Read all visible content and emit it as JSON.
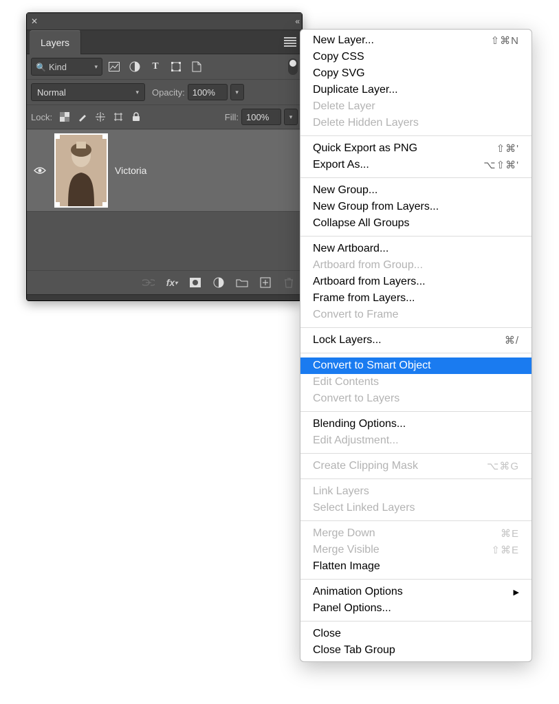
{
  "panel": {
    "tab_label": "Layers",
    "kind_filter_label": "Kind",
    "blend_mode": "Normal",
    "opacity_label": "Opacity:",
    "opacity_value": "100%",
    "lock_label": "Lock:",
    "fill_label": "Fill:",
    "fill_value": "100%",
    "layer": {
      "name": "Victoria"
    }
  },
  "menu": {
    "groups": [
      [
        {
          "label": "New Layer...",
          "shortcut": "⇧⌘N",
          "enabled": true
        },
        {
          "label": "Copy CSS",
          "enabled": true
        },
        {
          "label": "Copy SVG",
          "enabled": true
        },
        {
          "label": "Duplicate Layer...",
          "enabled": true
        },
        {
          "label": "Delete Layer",
          "enabled": false
        },
        {
          "label": "Delete Hidden Layers",
          "enabled": false
        }
      ],
      [
        {
          "label": "Quick Export as PNG",
          "shortcut": "⇧⌘'",
          "enabled": true
        },
        {
          "label": "Export As...",
          "shortcut": "⌥⇧⌘'",
          "enabled": true
        }
      ],
      [
        {
          "label": "New Group...",
          "enabled": true
        },
        {
          "label": "New Group from Layers...",
          "enabled": true
        },
        {
          "label": "Collapse All Groups",
          "enabled": true
        }
      ],
      [
        {
          "label": "New Artboard...",
          "enabled": true
        },
        {
          "label": "Artboard from Group...",
          "enabled": false
        },
        {
          "label": "Artboard from Layers...",
          "enabled": true
        },
        {
          "label": "Frame from Layers...",
          "enabled": true
        },
        {
          "label": "Convert to Frame",
          "enabled": false
        }
      ],
      [
        {
          "label": "Lock Layers...",
          "shortcut": "⌘/",
          "enabled": true
        }
      ],
      [
        {
          "label": "Convert to Smart Object",
          "enabled": true,
          "selected": true
        },
        {
          "label": "Edit Contents",
          "enabled": false
        },
        {
          "label": "Convert to Layers",
          "enabled": false
        }
      ],
      [
        {
          "label": "Blending Options...",
          "enabled": true
        },
        {
          "label": "Edit Adjustment...",
          "enabled": false
        }
      ],
      [
        {
          "label": "Create Clipping Mask",
          "shortcut": "⌥⌘G",
          "enabled": false
        }
      ],
      [
        {
          "label": "Link Layers",
          "enabled": false
        },
        {
          "label": "Select Linked Layers",
          "enabled": false
        }
      ],
      [
        {
          "label": "Merge Down",
          "shortcut": "⌘E",
          "enabled": false
        },
        {
          "label": "Merge Visible",
          "shortcut": "⇧⌘E",
          "enabled": false
        },
        {
          "label": "Flatten Image",
          "enabled": true
        }
      ],
      [
        {
          "label": "Animation Options",
          "enabled": true,
          "submenu": true
        },
        {
          "label": "Panel Options...",
          "enabled": true
        }
      ],
      [
        {
          "label": "Close",
          "enabled": true
        },
        {
          "label": "Close Tab Group",
          "enabled": true
        }
      ]
    ]
  }
}
